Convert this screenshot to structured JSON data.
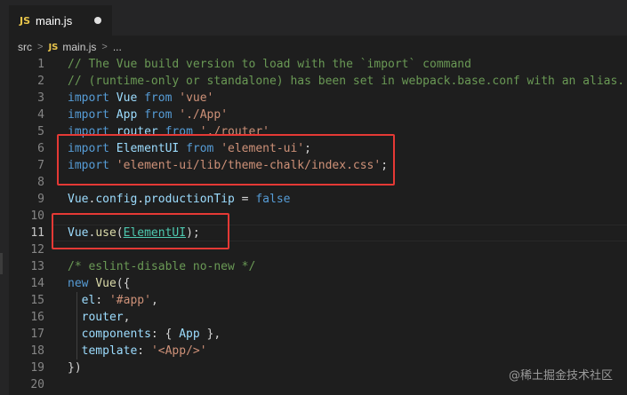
{
  "tab": {
    "badge": "JS",
    "label": "main.js"
  },
  "breadcrumb": {
    "folder": "src",
    "sep1": ">",
    "badge": "JS",
    "file": "main.js",
    "sep2": ">",
    "ellipsis": "..."
  },
  "lines": [
    {
      "num": "1",
      "tokens": [
        {
          "t": "// The Vue build version to load with the `import` command",
          "c": "comment"
        }
      ]
    },
    {
      "num": "2",
      "tokens": [
        {
          "t": "// (runtime-only or standalone) has been set in webpack.base.conf with an alias.",
          "c": "comment"
        }
      ]
    },
    {
      "num": "3",
      "tokens": [
        {
          "t": "import",
          "c": "kw"
        },
        {
          "t": " Vue ",
          "c": "var"
        },
        {
          "t": "from",
          "c": "kw"
        },
        {
          "t": " ",
          "c": "plain"
        },
        {
          "t": "'vue'",
          "c": "str"
        }
      ]
    },
    {
      "num": "4",
      "tokens": [
        {
          "t": "import",
          "c": "kw"
        },
        {
          "t": " App ",
          "c": "var"
        },
        {
          "t": "from",
          "c": "kw"
        },
        {
          "t": " ",
          "c": "plain"
        },
        {
          "t": "'./App'",
          "c": "str"
        }
      ]
    },
    {
      "num": "5",
      "tokens": [
        {
          "t": "import",
          "c": "kw"
        },
        {
          "t": " router ",
          "c": "var"
        },
        {
          "t": "from",
          "c": "kw"
        },
        {
          "t": " ",
          "c": "plain"
        },
        {
          "t": "'./router'",
          "c": "str"
        }
      ]
    },
    {
      "num": "6",
      "tokens": [
        {
          "t": "import",
          "c": "kw"
        },
        {
          "t": " ElementUI ",
          "c": "var"
        },
        {
          "t": "from",
          "c": "kw"
        },
        {
          "t": " ",
          "c": "plain"
        },
        {
          "t": "'element-ui'",
          "c": "str"
        },
        {
          "t": ";",
          "c": "plain"
        }
      ]
    },
    {
      "num": "7",
      "tokens": [
        {
          "t": "import",
          "c": "kw"
        },
        {
          "t": " ",
          "c": "plain"
        },
        {
          "t": "'element-ui/lib/theme-chalk/index.css'",
          "c": "str"
        },
        {
          "t": ";",
          "c": "plain"
        }
      ]
    },
    {
      "num": "8",
      "tokens": []
    },
    {
      "num": "9",
      "tokens": [
        {
          "t": "Vue",
          "c": "var"
        },
        {
          "t": ".",
          "c": "plain"
        },
        {
          "t": "config",
          "c": "var"
        },
        {
          "t": ".",
          "c": "plain"
        },
        {
          "t": "productionTip",
          "c": "var"
        },
        {
          "t": " = ",
          "c": "plain"
        },
        {
          "t": "false",
          "c": "bool"
        }
      ]
    },
    {
      "num": "10",
      "tokens": []
    },
    {
      "num": "11",
      "tokens": [
        {
          "t": "Vue",
          "c": "var"
        },
        {
          "t": ".",
          "c": "plain"
        },
        {
          "t": "use",
          "c": "fn"
        },
        {
          "t": "(",
          "c": "plain"
        },
        {
          "t": "ElementUI",
          "c": "link"
        },
        {
          "t": ");",
          "c": "plain"
        }
      ]
    },
    {
      "num": "12",
      "tokens": []
    },
    {
      "num": "13",
      "tokens": [
        {
          "t": "/* eslint-disable no-new */",
          "c": "comment"
        }
      ]
    },
    {
      "num": "14",
      "tokens": [
        {
          "t": "new",
          "c": "kw"
        },
        {
          "t": " ",
          "c": "plain"
        },
        {
          "t": "Vue",
          "c": "fn"
        },
        {
          "t": "({",
          "c": "plain"
        }
      ]
    },
    {
      "num": "15",
      "tokens": [
        {
          "t": "  el",
          "c": "prop"
        },
        {
          "t": ": ",
          "c": "plain"
        },
        {
          "t": "'#app'",
          "c": "str"
        },
        {
          "t": ",",
          "c": "plain"
        }
      ]
    },
    {
      "num": "16",
      "tokens": [
        {
          "t": "  router",
          "c": "prop"
        },
        {
          "t": ",",
          "c": "plain"
        }
      ]
    },
    {
      "num": "17",
      "tokens": [
        {
          "t": "  components",
          "c": "prop"
        },
        {
          "t": ": { ",
          "c": "plain"
        },
        {
          "t": "App",
          "c": "var"
        },
        {
          "t": " },",
          "c": "plain"
        }
      ]
    },
    {
      "num": "18",
      "tokens": [
        {
          "t": "  template",
          "c": "prop"
        },
        {
          "t": ": ",
          "c": "plain"
        },
        {
          "t": "'<App/>'",
          "c": "str"
        }
      ]
    },
    {
      "num": "19",
      "tokens": [
        {
          "t": "})",
          "c": "plain"
        }
      ]
    },
    {
      "num": "20",
      "tokens": []
    }
  ],
  "watermark": "@稀土掘金技术社区",
  "colors": {
    "highlight": "#e53935",
    "background": "#1e1e1e"
  }
}
